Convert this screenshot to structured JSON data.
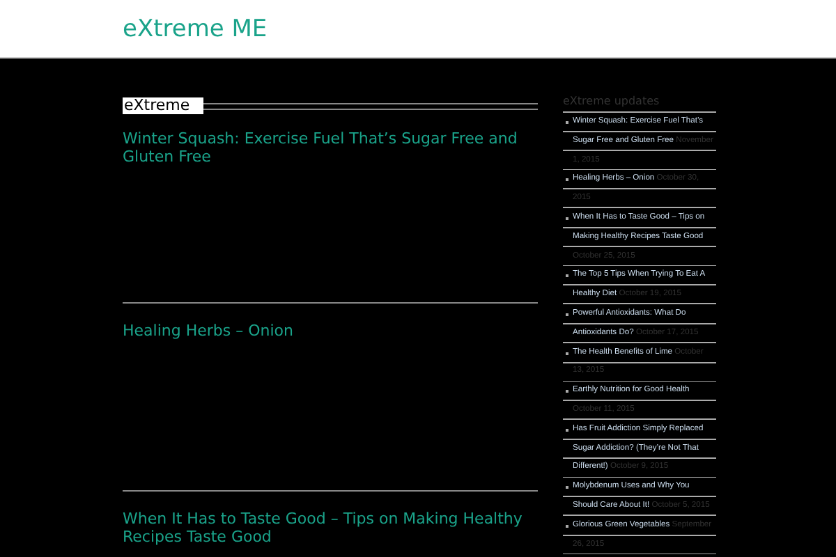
{
  "site_title": "eXtreme ME",
  "section_heading": "eXtreme",
  "posts": [
    {
      "title": "Winter Squash: Exercise Fuel That’s Sugar Free and Gluten Free"
    },
    {
      "title": "Healing Herbs – Onion"
    },
    {
      "title": "When It Has to Taste Good – Tips on Making Healthy Recipes Taste Good"
    }
  ],
  "sidebar": {
    "heading": "eXtreme updates",
    "items": [
      {
        "title": "Winter Squash: Exercise Fuel That’s Sugar Free and Gluten Free",
        "date": "November 1, 2015"
      },
      {
        "title": "Healing Herbs – Onion",
        "date": "October 30, 2015"
      },
      {
        "title": "When It Has to Taste Good – Tips on Making Healthy Recipes Taste Good",
        "date": "October 25, 2015"
      },
      {
        "title": "The Top 5 Tips When Trying To Eat A Healthy Diet",
        "date": "October 19, 2015"
      },
      {
        "title": "Powerful Antioxidants: What Do Antioxidants Do?",
        "date": "October 17, 2015"
      },
      {
        "title": "The Health Benefits of Lime",
        "date": "October 13, 2015"
      },
      {
        "title": "Earthly Nutrition for Good Health",
        "date": "October 11, 2015"
      },
      {
        "title": "Has Fruit Addiction Simply Replaced Sugar Addiction? (They’re Not That Different!)",
        "date": "October 9, 2015"
      },
      {
        "title": "Molybdenum Uses and Why You Should Care About It!",
        "date": "October 5, 2015"
      },
      {
        "title": "Glorious Green Vegetables",
        "date": "September 26, 2015"
      }
    ]
  }
}
